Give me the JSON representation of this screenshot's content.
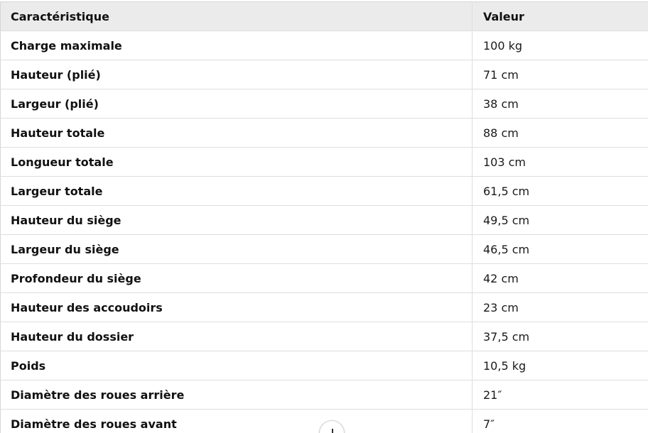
{
  "table": {
    "headers": [
      "Caractéristique",
      "Valeur"
    ],
    "rows": [
      [
        "Charge maximale",
        "100 kg"
      ],
      [
        "Hauteur (plié)",
        "71 cm"
      ],
      [
        "Largeur (plié)",
        "38 cm"
      ],
      [
        "Hauteur totale",
        "88 cm"
      ],
      [
        "Longueur totale",
        "103 cm"
      ],
      [
        "Largeur totale",
        "61,5 cm"
      ],
      [
        "Hauteur du siège",
        "49,5 cm"
      ],
      [
        "Largeur du siège",
        "46,5 cm"
      ],
      [
        "Profondeur du siège",
        "42 cm"
      ],
      [
        "Hauteur des accoudoirs",
        "23 cm"
      ],
      [
        "Hauteur du dossier",
        "37,5 cm"
      ],
      [
        "Poids",
        "10,5 kg"
      ],
      [
        "Diamètre des roues arrière",
        "21″"
      ],
      [
        "Diamètre des roues avant",
        "7″"
      ]
    ]
  },
  "scroll_button": {
    "icon": "arrow-down-icon"
  }
}
